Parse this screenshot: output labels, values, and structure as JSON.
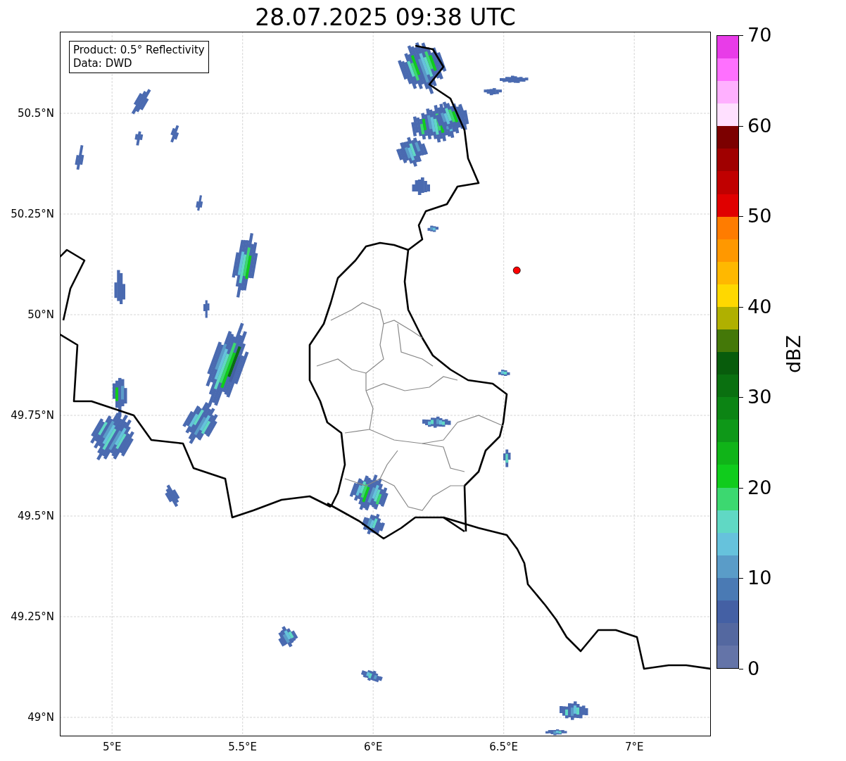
{
  "title": "28.07.2025 09:38 UTC",
  "info_box": {
    "lines": [
      "Product: 0.5° Reflectivity",
      "Data: DWD"
    ]
  },
  "map": {
    "y_ticks": [
      "50.5°N",
      "50.25°N",
      "50°N",
      "49.75°N",
      "49.5°N",
      "49.25°N",
      "49°N"
    ],
    "x_ticks": [
      "5°E",
      "5.5°E",
      "6°E",
      "6.5°E",
      "7°E"
    ]
  },
  "colorbar": {
    "label": "dBZ",
    "ticks": [
      "70",
      "60",
      "50",
      "40",
      "30",
      "20",
      "10",
      "0"
    ],
    "segments": [
      {
        "color": "#e83ce8"
      },
      {
        "color": "#ff70ff"
      },
      {
        "color": "#ffb0ff"
      },
      {
        "color": "#ffe0ff"
      },
      {
        "color": "#7c0000"
      },
      {
        "color": "#a00000"
      },
      {
        "color": "#c00000"
      },
      {
        "color": "#e00000"
      },
      {
        "color": "#ff7c00"
      },
      {
        "color": "#ff9800"
      },
      {
        "color": "#ffb800"
      },
      {
        "color": "#ffd800"
      },
      {
        "color": "#b0b000"
      },
      {
        "color": "#447808"
      },
      {
        "color": "#085c0c"
      },
      {
        "color": "#0a7010"
      },
      {
        "color": "#0c8414"
      },
      {
        "color": "#0e9818"
      },
      {
        "color": "#10b418"
      },
      {
        "color": "#10cc1c"
      },
      {
        "color": "#3cd870"
      },
      {
        "color": "#60d8c4"
      },
      {
        "color": "#66c2dc"
      },
      {
        "color": "#5a9cc8"
      },
      {
        "color": "#4a7ab4"
      },
      {
        "color": "#4460a4"
      },
      {
        "color": "#5468a0"
      },
      {
        "color": "#6474a8"
      }
    ]
  }
}
